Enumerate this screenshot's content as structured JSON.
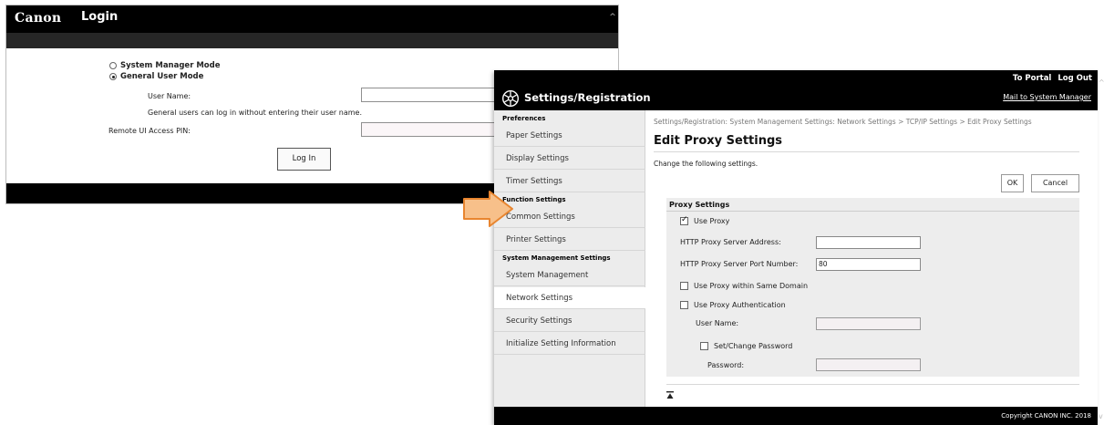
{
  "login": {
    "brand": "Canon",
    "title": "Login",
    "mode_system": "System Manager Mode",
    "mode_general": "General User Mode",
    "user_name_label": "User Name:",
    "note": "General users can log in without entering their user name.",
    "pin_label": "Remote UI Access PIN:",
    "login_button": "Log In"
  },
  "settings": {
    "title": "Settings/Registration",
    "to_portal": "To Portal",
    "log_out": "Log Out",
    "mail": "Mail to System Manager",
    "sidebar": {
      "cat_preferences": "Preferences",
      "paper": "Paper Settings",
      "display": "Display Settings",
      "timer": "Timer Settings",
      "cat_function": "Function Settings",
      "common": "Common Settings",
      "printer": "Printer Settings",
      "cat_system": "System Management Settings",
      "system_mgmt": "System Management",
      "network": "Network Settings",
      "security": "Security Settings",
      "initialize": "Initialize Setting Information"
    },
    "breadcrumb": "Settings/Registration: System Management Settings: Network Settings > TCP/IP Settings > Edit Proxy Settings",
    "page_title": "Edit Proxy Settings",
    "description": "Change the following settings.",
    "ok": "OK",
    "cancel": "Cancel",
    "panel": {
      "heading": "Proxy Settings",
      "use_proxy": "Use Proxy",
      "http_address_label": "HTTP Proxy Server Address:",
      "http_address_value": "",
      "http_port_label": "HTTP Proxy Server Port Number:",
      "http_port_value": "80",
      "same_domain": "Use Proxy within Same Domain",
      "use_auth": "Use Proxy Authentication",
      "user_name_label": "User Name:",
      "set_password": "Set/Change Password",
      "password_label": "Password:"
    },
    "copyright": "Copyright CANON INC. 2018"
  },
  "arrow_icon": "right-arrow-icon",
  "colors": {
    "arrow_fill": "#f7c08a",
    "arrow_stroke": "#e8852f"
  }
}
